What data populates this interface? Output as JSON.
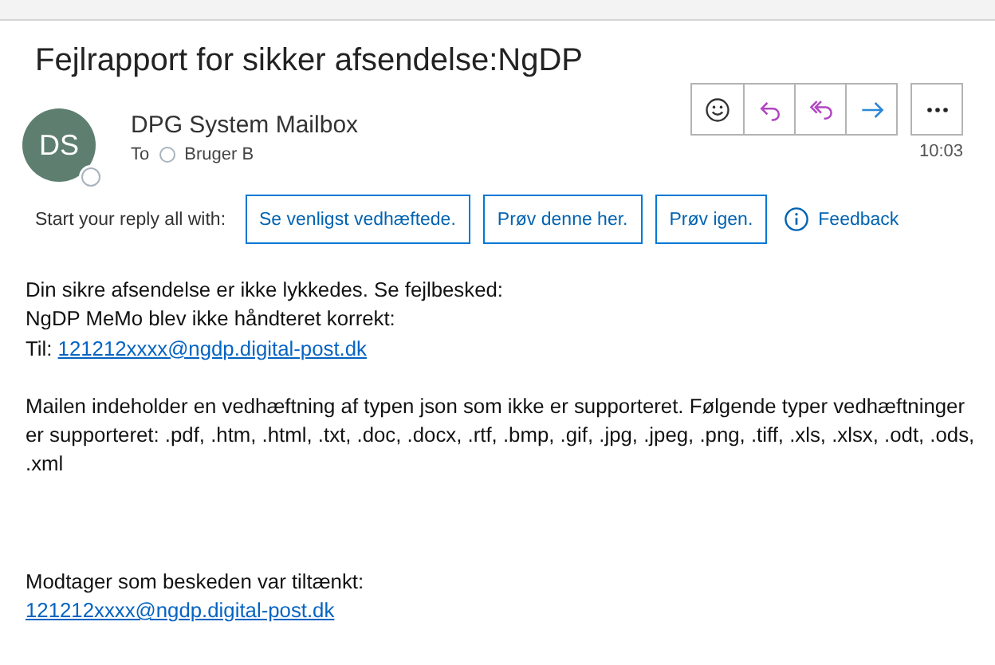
{
  "subject": "Fejlrapport for sikker afsendelse:NgDP",
  "sender": {
    "initials": "DS",
    "name": "DPG System Mailbox",
    "online": false
  },
  "to": {
    "label": "To",
    "recipient": "Bruger B"
  },
  "time": "10:03",
  "suggestions": {
    "label": "Start your reply all with:",
    "replies": [
      "Se venligst vedhæftede.",
      "Prøv denne her.",
      "Prøv igen."
    ],
    "feedback": "Feedback"
  },
  "body": [
    {
      "lines": [
        {
          "text": "Din sikre afsendelse er ikke lykkedes. Se fejlbesked:"
        },
        {
          "text": "NgDP MeMo blev ikke håndteret korrekt:"
        },
        {
          "text": "Til: ",
          "link": "121212xxxx@ngdp.digital-post.dk"
        }
      ]
    },
    {
      "lines": [
        {
          "text": "Mailen indeholder en vedhæftning af typen json som ikke er supporteret. Følgende typer vedhæftninger er supporteret: .pdf, .htm, .html, .txt, .doc, .docx, .rtf, .bmp, .gif, .jpg, .jpeg, .png, .tiff, .xls, .xlsx, .odt, .ods, .xml"
        }
      ]
    },
    {
      "kind": "footer",
      "lines": [
        {
          "text": "Modtager som beskeden var tiltænkt:"
        },
        {
          "link": "121212xxxx@ngdp.digital-post.dk"
        }
      ]
    }
  ]
}
